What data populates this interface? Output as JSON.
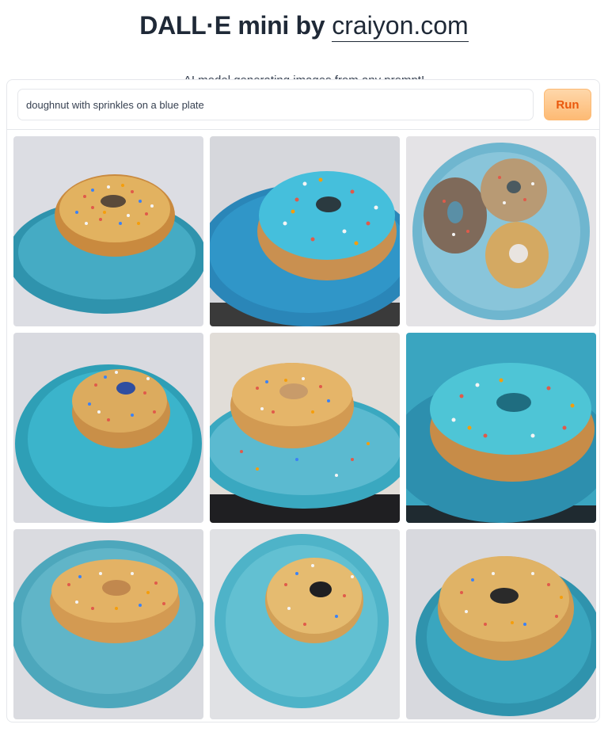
{
  "header": {
    "brand": "DALL·E mini by",
    "site": "craiyon.com",
    "subtitle": "AI model generating images from any prompt!"
  },
  "prompt": {
    "value": "doughnut with sprinkles on a blue plate",
    "run_label": "Run"
  },
  "gallery": {
    "images": [
      {
        "label": "generated-image-1"
      },
      {
        "label": "generated-image-2"
      },
      {
        "label": "generated-image-3"
      },
      {
        "label": "generated-image-4"
      },
      {
        "label": "generated-image-5"
      },
      {
        "label": "generated-image-6"
      },
      {
        "label": "generated-image-7"
      },
      {
        "label": "generated-image-8"
      },
      {
        "label": "generated-image-9"
      }
    ]
  },
  "colors": {
    "plate_blue": "#3fa9c2",
    "dough": "#d9a55a",
    "icing_blue": "#55c4d6",
    "run_text": "#ea580c"
  }
}
